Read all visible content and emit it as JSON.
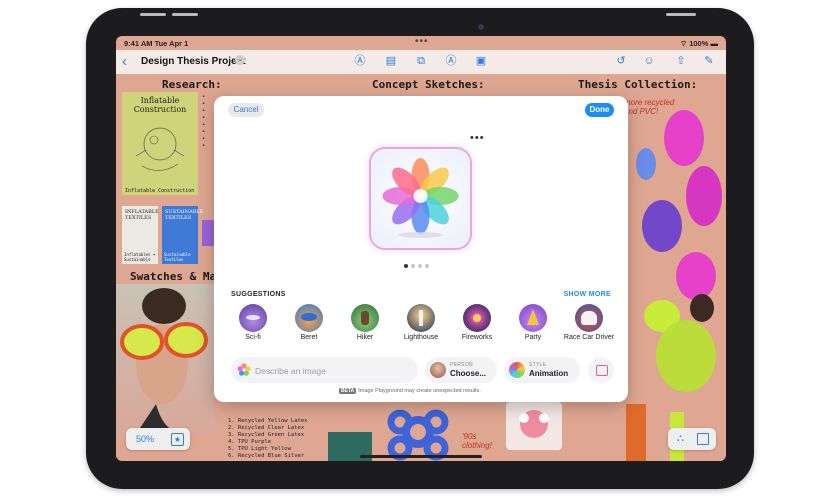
{
  "status": {
    "time": "9:41 AM  Tue Apr 1",
    "battery": "100%"
  },
  "toolbar": {
    "title": "Design Thesis Project"
  },
  "board": {
    "headings": [
      "Research:",
      "Concept Sketches:",
      "Thesis Collection:",
      "Swatches & Mak"
    ],
    "poster1": "Inflatable Construction",
    "poster1_caption": "Inflatable Construction",
    "poster2": "INFLATABLE TEXTILES",
    "poster3": "SUSTAINABLE TEXTILES",
    "poster2_caption": "Inflatables + Sustainable",
    "poster3_caption": "Sustainable Textiles",
    "scrawl_top": "more recycled and PVC!",
    "scrawl_bottom": "'90s clothing!",
    "materials": [
      "1. Recycled Yellow Latex",
      "2. Recycled Clear Latex",
      "3. Recycled Green Latex",
      "4. TPU Purple",
      "5. TPU Light Yellow",
      "6. Recycled Blue Silver"
    ]
  },
  "zoom": {
    "value": "50%"
  },
  "dialog": {
    "cancel": "Cancel",
    "done": "Done",
    "more": "•••",
    "suggestions_title": "SUGGESTIONS",
    "show_more": "SHOW MORE",
    "suggestions": [
      {
        "label": "Sci-fi"
      },
      {
        "label": "Beret"
      },
      {
        "label": "Hiker"
      },
      {
        "label": "Lighthouse"
      },
      {
        "label": "Fireworks"
      },
      {
        "label": "Party"
      },
      {
        "label": "Race Car Driver"
      }
    ],
    "describe_placeholder": "Describe an image",
    "person_small": "PERSON",
    "person_big": "Choose...",
    "style_small": "STYLE",
    "style_big": "Animation",
    "beta_tag": "BETA",
    "beta_text": "Image Playground may create unexpected results."
  }
}
